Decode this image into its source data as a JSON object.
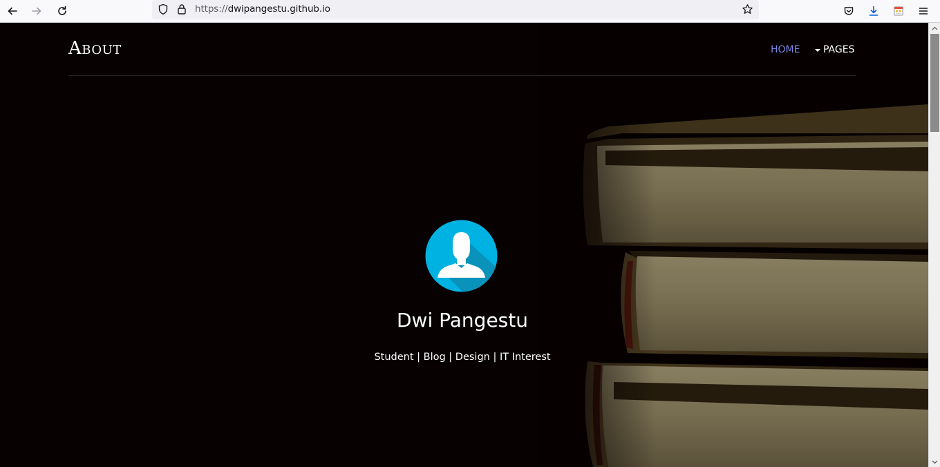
{
  "browser": {
    "url_scheme": "https://",
    "url_host": "dwipangestu.github.io",
    "icons": [
      "back-arrow-icon",
      "forward-arrow-icon",
      "reload-icon",
      "shield-icon",
      "lock-icon",
      "bookmark-star-icon",
      "pocket-icon",
      "download-icon",
      "extension-icon",
      "hamburger-menu-icon"
    ]
  },
  "nav": {
    "brand": "About",
    "home_label": "HOME",
    "pages_label": "PAGES"
  },
  "profile": {
    "name": "Dwi Pangestu",
    "tagline": "Student | Blog | Design | IT Interest",
    "avatar_icon": "user-avatar-icon"
  },
  "colors": {
    "background": "#070102",
    "nav_active": "#7b86e8",
    "avatar_circle": "#00b2e2",
    "text": "#ffffff"
  }
}
